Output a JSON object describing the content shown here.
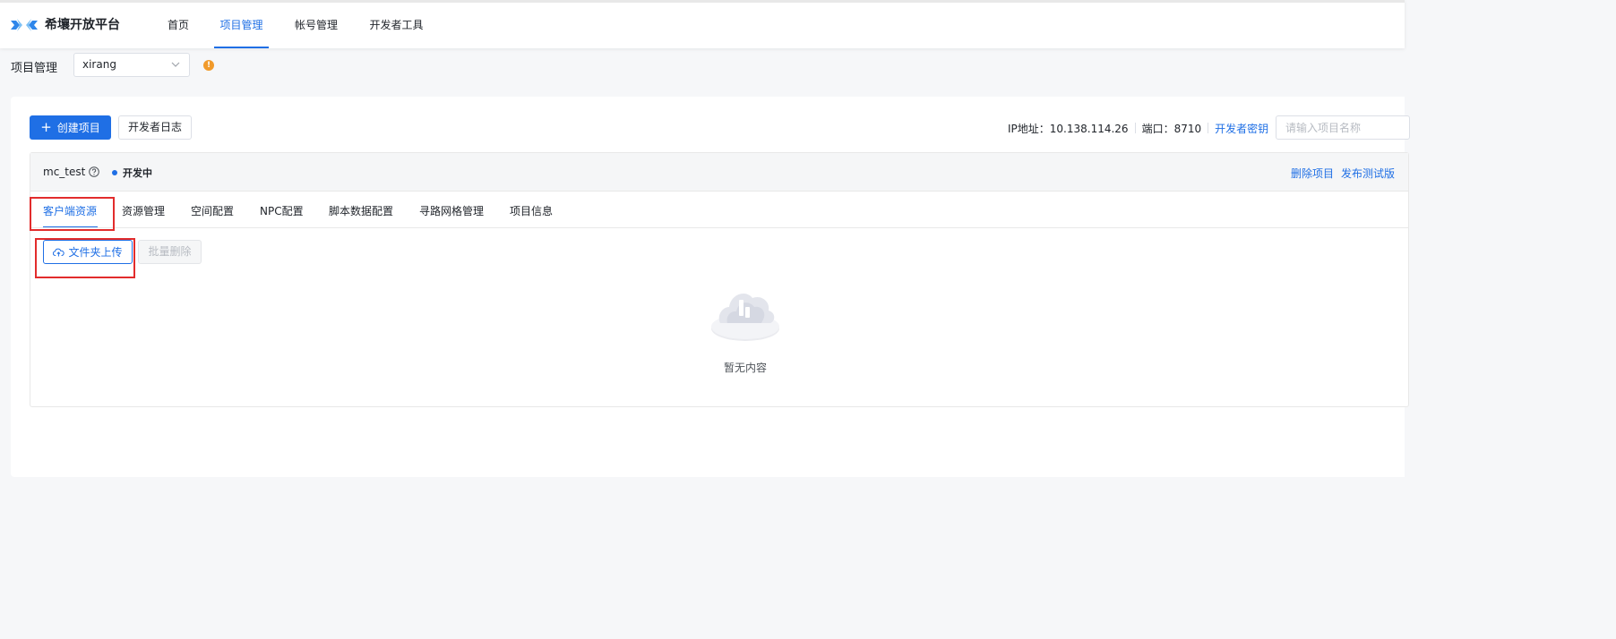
{
  "header": {
    "brand_name": "希壤开放平台",
    "nav": [
      {
        "label": "首页",
        "active": false
      },
      {
        "label": "项目管理",
        "active": true
      },
      {
        "label": "帐号管理",
        "active": false
      },
      {
        "label": "开发者工具",
        "active": false
      }
    ]
  },
  "subbar": {
    "title": "项目管理",
    "selected_project": "xirang",
    "info_badge": "!"
  },
  "toolbar": {
    "create_label": "创建项目",
    "log_label": "开发者日志",
    "ip_label": "IP地址：10.138.114.26",
    "port_label": "端口：8710",
    "key_link": "开发者密钥",
    "search_placeholder": "请输入项目名称"
  },
  "project": {
    "name": "mc_test",
    "status": "开发中",
    "actions": [
      "删除项目",
      "发布测试版"
    ],
    "tabs": [
      {
        "label": "客户端资源",
        "active": true
      },
      {
        "label": "资源管理",
        "active": false
      },
      {
        "label": "空间配置",
        "active": false
      },
      {
        "label": "NPC配置",
        "active": false
      },
      {
        "label": "脚本数据配置",
        "active": false
      },
      {
        "label": "寻路网格管理",
        "active": false
      },
      {
        "label": "项目信息",
        "active": false
      }
    ],
    "upload_label": "文件夹上传",
    "batch_delete_label": "批量删除",
    "empty_text": "暂无内容"
  },
  "colors": {
    "accent": "#1f6fe5",
    "highlight": "#e22c2c",
    "warning": "#f19a2b"
  }
}
